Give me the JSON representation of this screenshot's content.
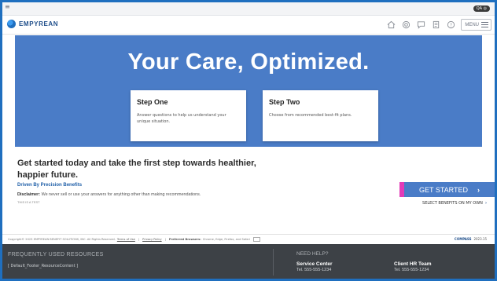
{
  "topbar": {
    "menu_glyph": "≡",
    "env_badge": "QA ◎"
  },
  "header": {
    "logo_text": "EMPYREAN",
    "menu_label": "MENU",
    "icons": [
      "home-icon",
      "support-icon",
      "chat-icon",
      "document-icon",
      "help-icon"
    ]
  },
  "hero": {
    "title": "Your Care, Optimized.",
    "steps": [
      {
        "title": "Step One",
        "description": "Answer questions to help us understand your unique situation."
      },
      {
        "title": "Step Two",
        "description": "Choose from recommended best-fit plans."
      }
    ]
  },
  "main": {
    "tagline": "Get started today and take the first step towards healthier, happier future.",
    "subheading": "Driven By Precision Benefits",
    "disclaimer_label": "Disclaimer:",
    "disclaimer_text": " We never sell or use your answers for anything other than making recommendations.",
    "test_note": "THIS IS A TEST",
    "get_started_label": "GET STARTED",
    "select_own_label": "SELECT BENEFITS ON MY OWN"
  },
  "footer": {
    "copyright": "Copyright© 2023 EMPYREAN BENEFIT SOLUTIONS, INC. All Rights Reserved.",
    "terms_link": "Terms of Use",
    "privacy_link": "Privacy Policy",
    "browsers_label": "Preferred Browsers:",
    "browsers_text": " Chrome, Edge, Firefox, and Safari",
    "compass_logo": "COMPASS",
    "version": "2023.15",
    "resources_heading": "FREQUENTLY USED RESOURCES",
    "resources_content": "[ Default_Footer_ResourceContent ]",
    "help_heading": "NEED HELP?",
    "service_center_title": "Service Center",
    "service_center_phone": "Tel. 555-555-1234",
    "client_hr_title": "Client HR Team",
    "client_hr_phone": "Tel. 555-555-1234"
  },
  "colors": {
    "hero_bg": "#4a7cc7",
    "accent_pink": "#e23bb8",
    "brand_blue": "#1f4e8a",
    "footer_dark": "#3d4146"
  }
}
